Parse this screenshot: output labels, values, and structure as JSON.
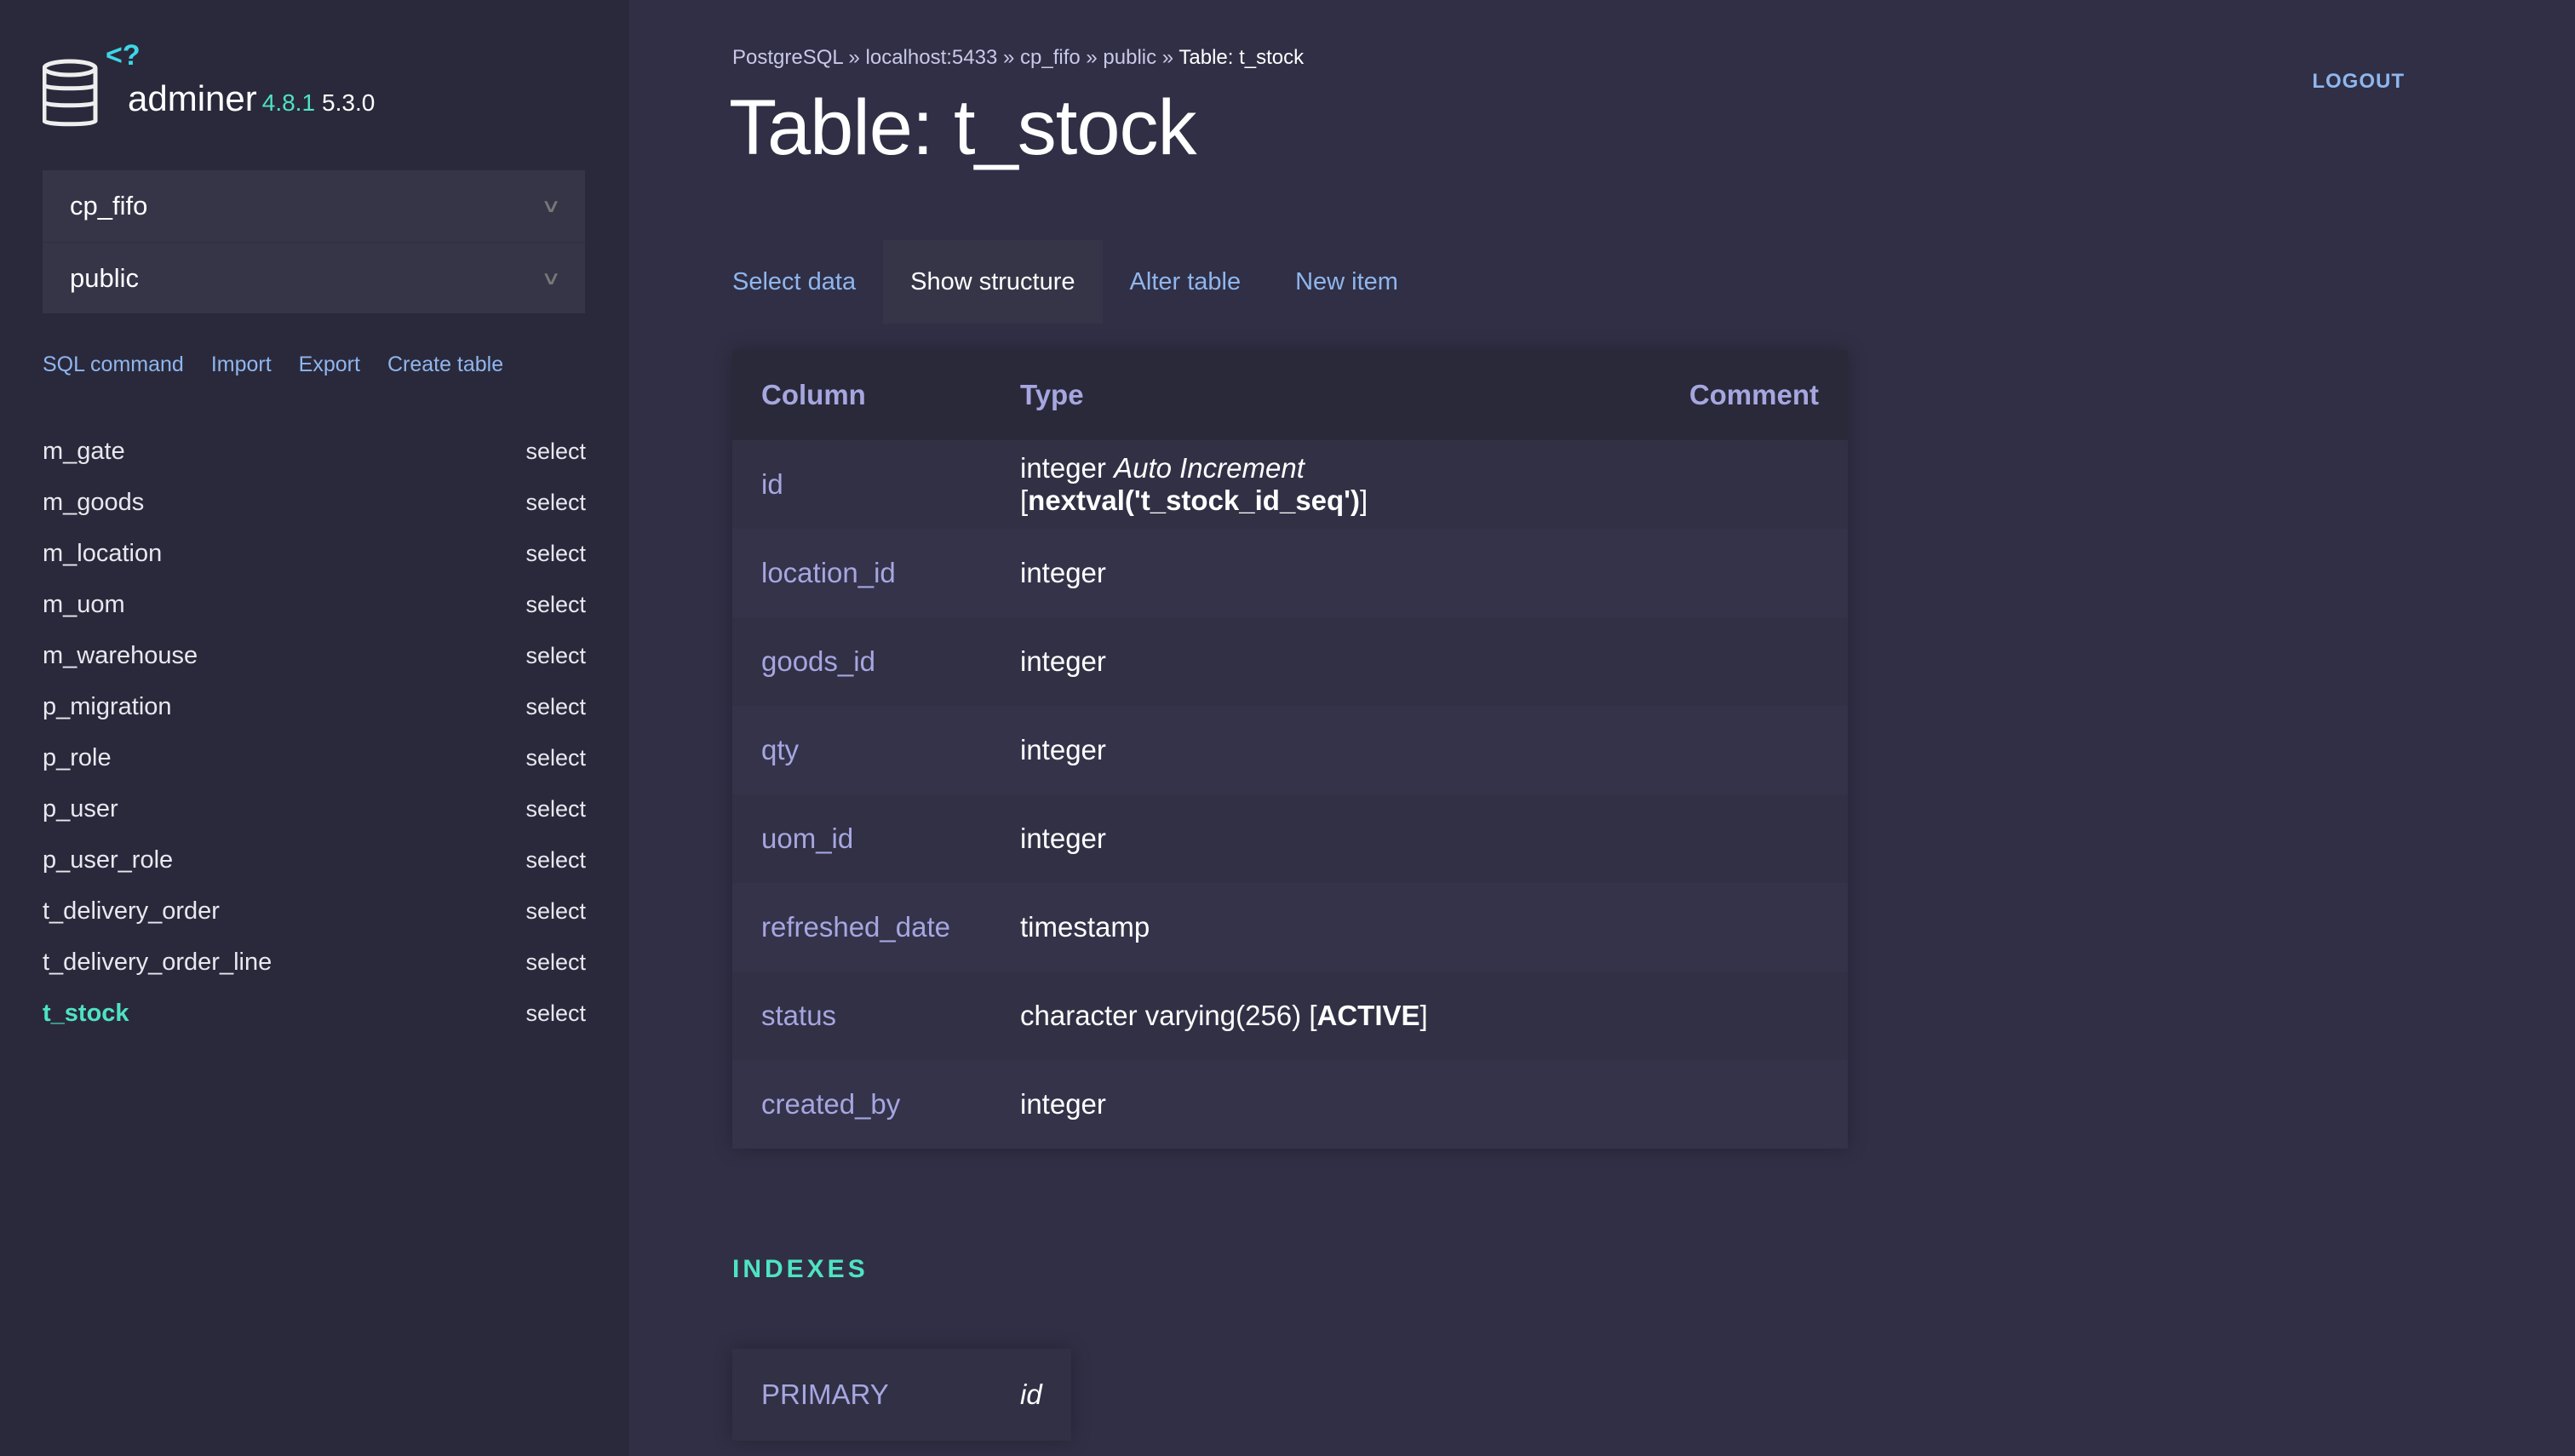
{
  "app": {
    "name": "adminer",
    "version": "4.8.1",
    "version2": "5.3.0"
  },
  "sidebar": {
    "database": "cp_fifo",
    "schema": "public",
    "links": [
      "SQL command",
      "Import",
      "Export",
      "Create table"
    ],
    "tables": [
      {
        "name": "m_gate",
        "action": "select"
      },
      {
        "name": "m_goods",
        "action": "select"
      },
      {
        "name": "m_location",
        "action": "select"
      },
      {
        "name": "m_uom",
        "action": "select"
      },
      {
        "name": "m_warehouse",
        "action": "select"
      },
      {
        "name": "p_migration",
        "action": "select"
      },
      {
        "name": "p_role",
        "action": "select"
      },
      {
        "name": "p_user",
        "action": "select"
      },
      {
        "name": "p_user_role",
        "action": "select"
      },
      {
        "name": "t_delivery_order",
        "action": "select"
      },
      {
        "name": "t_delivery_order_line",
        "action": "select"
      },
      {
        "name": "t_stock",
        "action": "select",
        "active": true
      }
    ]
  },
  "breadcrumb": [
    "PostgreSQL",
    "localhost:5433",
    "cp_fifo",
    "public",
    "Table: t_stock"
  ],
  "breadcrumb_sep": " » ",
  "title": "Table: t_stock",
  "logout": "LOGOUT",
  "tabs": [
    "Select data",
    "Show structure",
    "Alter table",
    "New item"
  ],
  "structure": {
    "headers": [
      "Column",
      "Type",
      "Comment"
    ],
    "rows": [
      {
        "column": "id",
        "type": "integer",
        "extra": "Auto Increment",
        "default_open": "[",
        "default": "nextval('t_stock_id_seq')",
        "default_close": "]"
      },
      {
        "column": "location_id",
        "type": "integer"
      },
      {
        "column": "goods_id",
        "type": "integer"
      },
      {
        "column": "qty",
        "type": "integer"
      },
      {
        "column": "uom_id",
        "type": "integer"
      },
      {
        "column": "refreshed_date",
        "type": "timestamp"
      },
      {
        "column": "status",
        "type": "character varying(256)",
        "default_open": "[",
        "default": "ACTIVE",
        "default_close": "]"
      },
      {
        "column": "created_by",
        "type": "integer"
      }
    ]
  },
  "indexes": {
    "heading": "INDEXES",
    "rows": [
      {
        "type": "PRIMARY",
        "columns": "id"
      }
    ]
  },
  "colors": {
    "accent": "#4fe3c1",
    "link": "#8fb6ee",
    "column": "#a6a6e0"
  }
}
